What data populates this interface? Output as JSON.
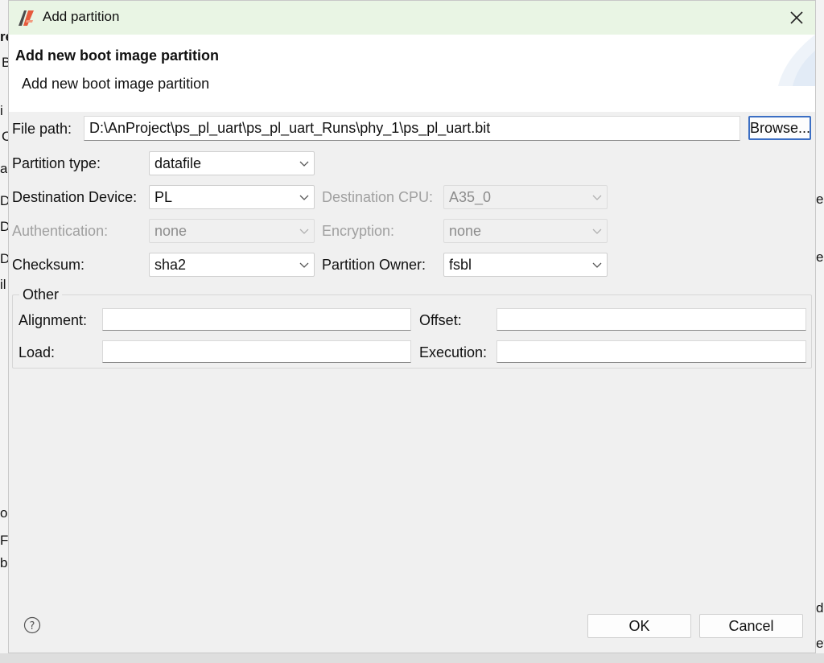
{
  "window": {
    "title": "Add partition"
  },
  "banner": {
    "title": "Add new boot image partition",
    "description": "Add new boot image partition"
  },
  "file_path": {
    "label": "File path:",
    "value": "D:\\AnProject\\ps_pl_uart\\ps_pl_uart_Runs\\phy_1\\ps_pl_uart.bit",
    "browse_label": "Browse..."
  },
  "partition_type": {
    "label": "Partition type:",
    "value": "datafile"
  },
  "destination_device": {
    "label": "Destination Device:",
    "value": "PL"
  },
  "destination_cpu": {
    "label": "Destination CPU:",
    "value": "A35_0",
    "enabled": false
  },
  "authentication": {
    "label": "Authentication:",
    "value": "none",
    "enabled": false
  },
  "encryption": {
    "label": "Encryption:",
    "value": "none",
    "enabled": false
  },
  "checksum": {
    "label": "Checksum:",
    "value": "sha2"
  },
  "partition_owner": {
    "label": "Partition Owner:",
    "value": "fsbl"
  },
  "other": {
    "legend": "Other",
    "alignment": {
      "label": "Alignment:",
      "value": ""
    },
    "offset": {
      "label": "Offset:",
      "value": ""
    },
    "load": {
      "label": "Load:",
      "value": ""
    },
    "execution": {
      "label": "Execution:",
      "value": ""
    }
  },
  "footer": {
    "ok_label": "OK",
    "cancel_label": "Cancel"
  },
  "background_fragments": [
    "re",
    "B",
    "i",
    "C",
    "a",
    "D",
    "D",
    "D",
    "il",
    "o",
    "Fi",
    "b",
    "e.",
    "e.",
    "d",
    "et"
  ],
  "colors": {
    "titlebar": "#e9f5e4",
    "dialog_bg": "#f0f0f0",
    "focus_border": "#3c6fc4",
    "disabled_text": "#a0a0a0"
  },
  "icons": [
    "app-logo-icon",
    "close-icon",
    "chevron-down-icon",
    "help-icon"
  ]
}
